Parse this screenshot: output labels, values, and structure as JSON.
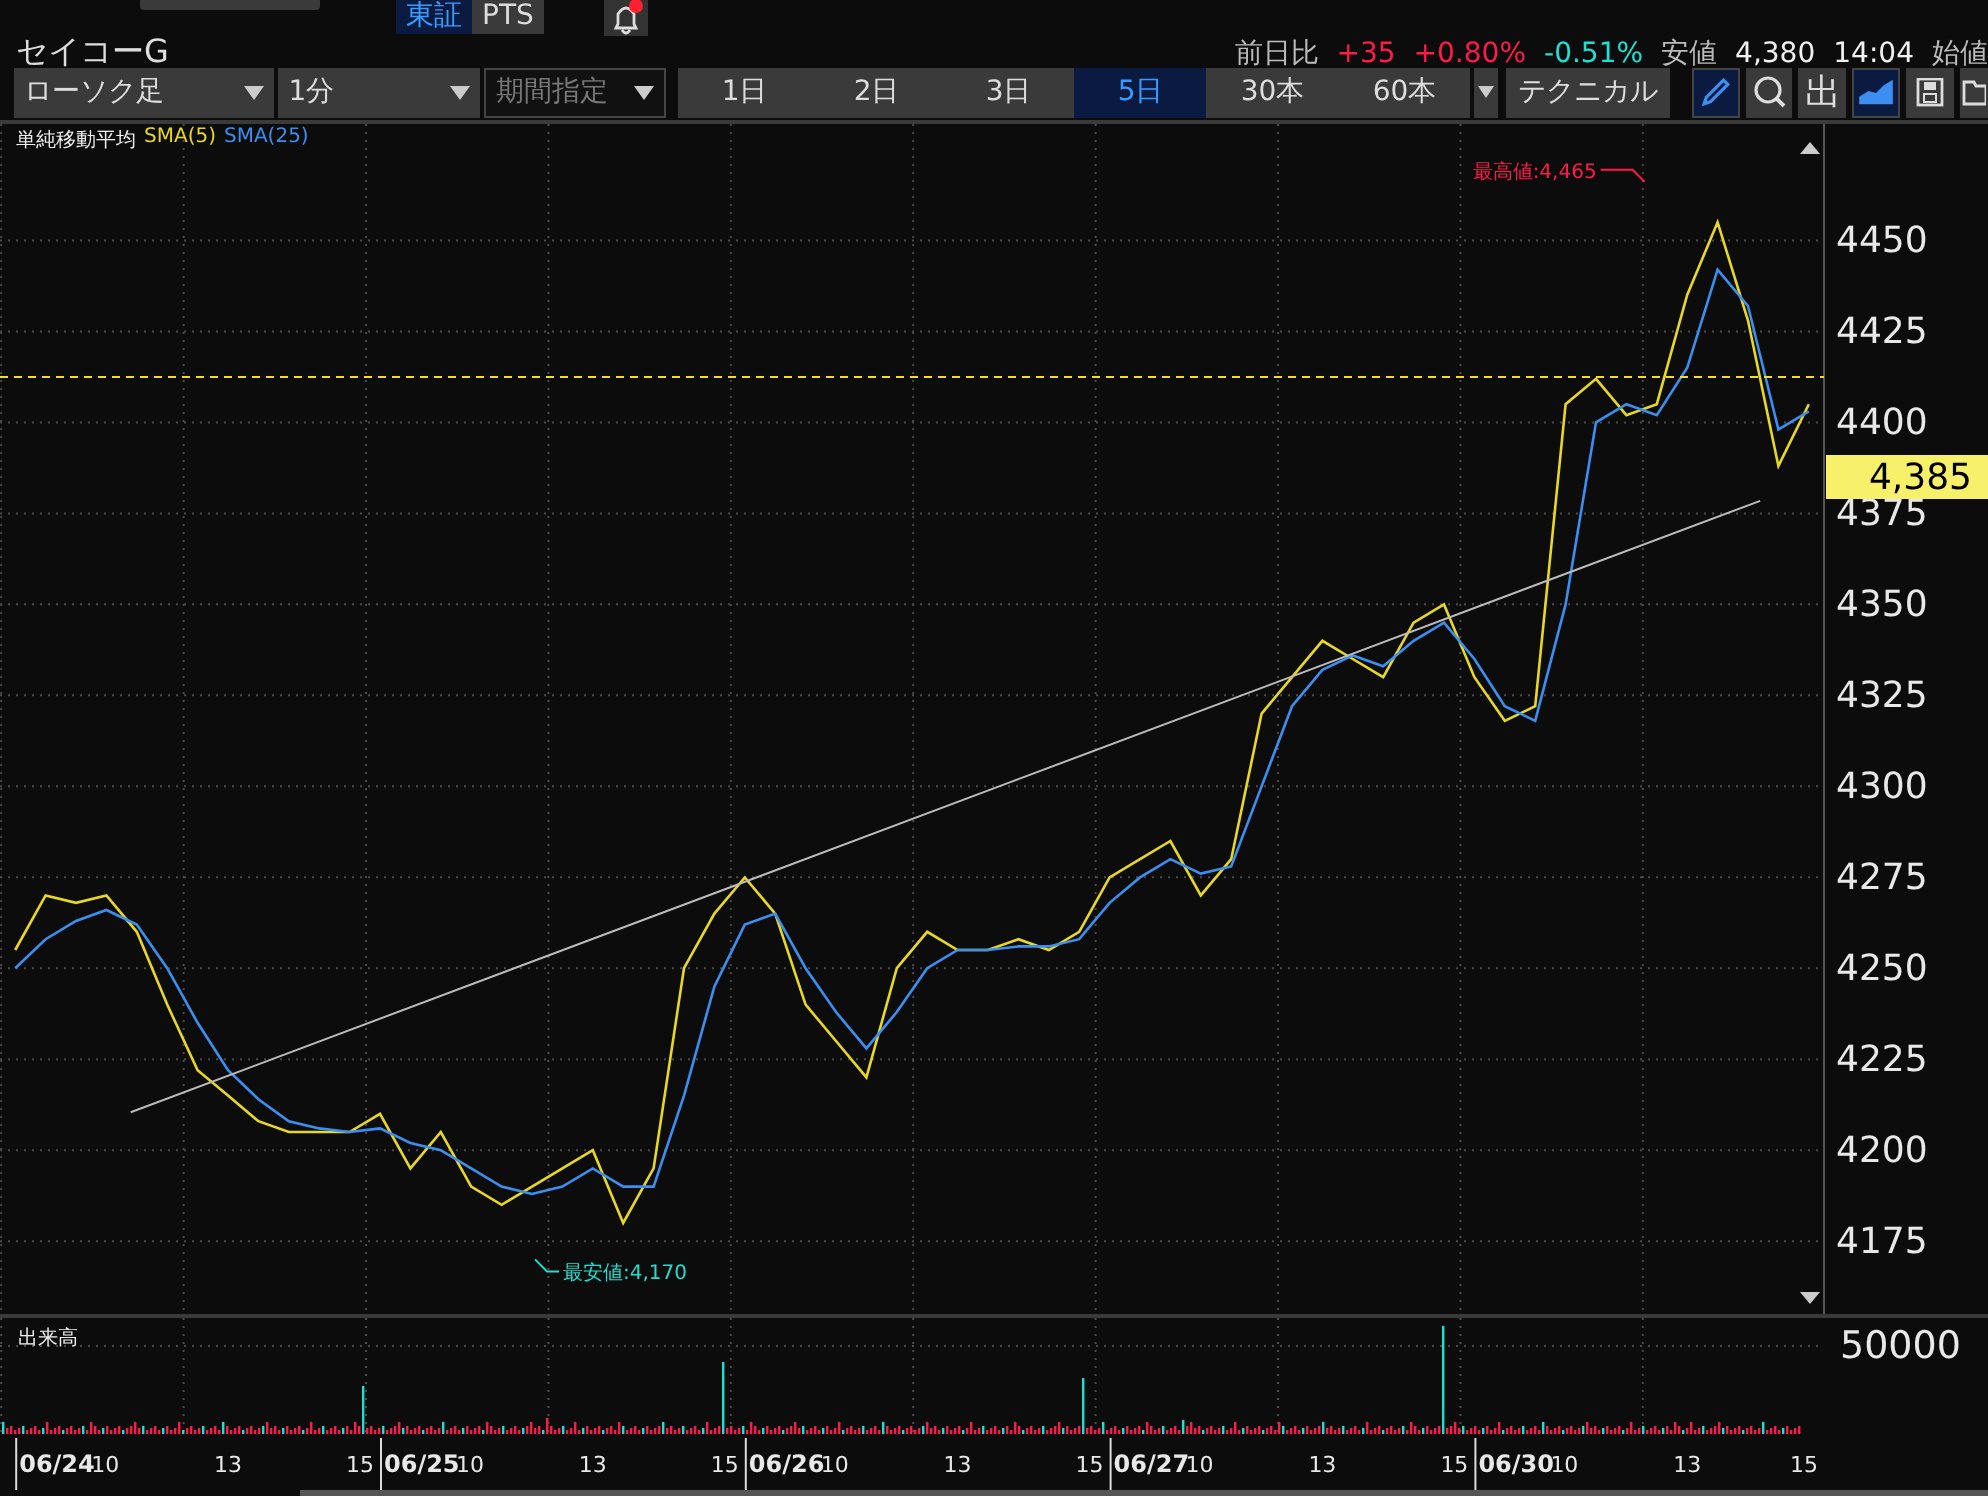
{
  "header": {
    "exchange_tabs": [
      {
        "label": "東証",
        "selected": true
      },
      {
        "label": "PTS",
        "selected": false
      }
    ]
  },
  "symbol": {
    "name": "セイコーG"
  },
  "quote": [
    {
      "kind": "label",
      "text": "前日比"
    },
    {
      "kind": "up",
      "text": "+35"
    },
    {
      "kind": "up",
      "text": "+0.80%"
    },
    {
      "kind": "down",
      "text": "-0.51%"
    },
    {
      "kind": "label",
      "text": "安値"
    },
    {
      "kind": "value",
      "text": "4,380"
    },
    {
      "kind": "value",
      "text": "14:04"
    },
    {
      "kind": "label",
      "text": "始値"
    }
  ],
  "toolbar": {
    "chart_type": "ローソク足",
    "interval": "1分",
    "range": {
      "label": "期間指定",
      "disabled": true
    },
    "periods": [
      {
        "label": "1日",
        "selected": false
      },
      {
        "label": "2日",
        "selected": false
      },
      {
        "label": "3日",
        "selected": false
      },
      {
        "label": "5日",
        "selected": true
      },
      {
        "label": "30本",
        "selected": false
      },
      {
        "label": "60本",
        "selected": false
      }
    ],
    "technical": "テクニカル",
    "tools": [
      {
        "kind": "pencil",
        "selected": true
      },
      {
        "kind": "zoom",
        "selected": false
      },
      {
        "kind": "text",
        "text": "出",
        "selected": false
      },
      {
        "kind": "area",
        "selected": true
      },
      {
        "kind": "save",
        "selected": false
      },
      {
        "kind": "folder",
        "selected": false
      }
    ]
  },
  "chart": {
    "indicator": "単純移動平均",
    "current_price": "4,385",
    "high_label": "最高値:4,465",
    "low_label": "最安値:4,170",
    "chart_data": {
      "type": "line",
      "grid": true,
      "categories": [
        null,
        null,
        null,
        null,
        null,
        null,
        null,
        null,
        null,
        null,
        null,
        null,
        null,
        null,
        null,
        null,
        null,
        null,
        null,
        null,
        null,
        null,
        null,
        null,
        null,
        null,
        null,
        null,
        null,
        null,
        null,
        null,
        null,
        null,
        null,
        null,
        null,
        null,
        null,
        null,
        null,
        null,
        null,
        null,
        null,
        null,
        null,
        null,
        null,
        null,
        null,
        null,
        null,
        null,
        null,
        null,
        null,
        null,
        null,
        null
      ],
      "series": [
        {
          "name": "SMA(5)",
          "color": "#e8d820",
          "values": [
            4255,
            4270,
            4268,
            4270,
            4260,
            4240,
            4222,
            4215,
            4208,
            4205,
            4205,
            4205,
            4210,
            4195,
            4205,
            4190,
            4185,
            4190,
            4195,
            4200,
            4180,
            4195,
            4250,
            4265,
            4275,
            4265,
            4240,
            4230,
            4220,
            4250,
            4260,
            4255,
            4255,
            4258,
            4255,
            4260,
            4275,
            4280,
            4285,
            4270,
            4280,
            4320,
            4330,
            4340,
            4335,
            4330,
            4345,
            4350,
            4330,
            4318,
            4322,
            4405,
            4412,
            4402,
            4405,
            4435,
            4455,
            4428,
            4388,
            4405
          ]
        },
        {
          "name": "SMA(25)",
          "color": "#3a8ff0",
          "values": [
            4250,
            4258,
            4263,
            4266,
            4262,
            4250,
            4235,
            4222,
            4214,
            4208,
            4206,
            4205,
            4206,
            4202,
            4200,
            4195,
            4190,
            4188,
            4190,
            4195,
            4190,
            4190,
            4215,
            4245,
            4262,
            4265,
            4250,
            4238,
            4228,
            4238,
            4250,
            4255,
            4255,
            4256,
            4256,
            4258,
            4268,
            4275,
            4280,
            4276,
            4278,
            4300,
            4322,
            4332,
            4336,
            4333,
            4340,
            4345,
            4335,
            4322,
            4318,
            4350,
            4400,
            4405,
            4402,
            4415,
            4442,
            4432,
            4398,
            4403
          ]
        }
      ],
      "ylim": [
        4155,
        4482
      ],
      "yticks": [
        4175,
        4200,
        4225,
        4250,
        4275,
        4300,
        4325,
        4350,
        4375,
        4400,
        4425,
        4450
      ]
    }
  },
  "time_axis": [
    {
      "kind": "date",
      "label": "06/24"
    },
    {
      "kind": "hour",
      "label": "10"
    },
    {
      "kind": "hour",
      "label": "13"
    },
    {
      "kind": "hour",
      "label": "15"
    },
    {
      "kind": "date",
      "label": "06/25"
    },
    {
      "kind": "hour",
      "label": "10"
    },
    {
      "kind": "hour",
      "label": "13"
    },
    {
      "kind": "hour",
      "label": "15"
    },
    {
      "kind": "date",
      "label": "06/26"
    },
    {
      "kind": "hour",
      "label": "10"
    },
    {
      "kind": "hour",
      "label": "13"
    },
    {
      "kind": "hour",
      "label": "15"
    },
    {
      "kind": "date",
      "label": "06/27"
    },
    {
      "kind": "hour",
      "label": "10"
    },
    {
      "kind": "hour",
      "label": "13"
    },
    {
      "kind": "hour",
      "label": "15"
    },
    {
      "kind": "date",
      "label": "06/30"
    },
    {
      "kind": "hour",
      "label": "10"
    },
    {
      "kind": "hour",
      "label": "13"
    },
    {
      "kind": "hour",
      "label": "15"
    }
  ],
  "volume": {
    "label": "出来高",
    "axis_label": "50000"
  }
}
